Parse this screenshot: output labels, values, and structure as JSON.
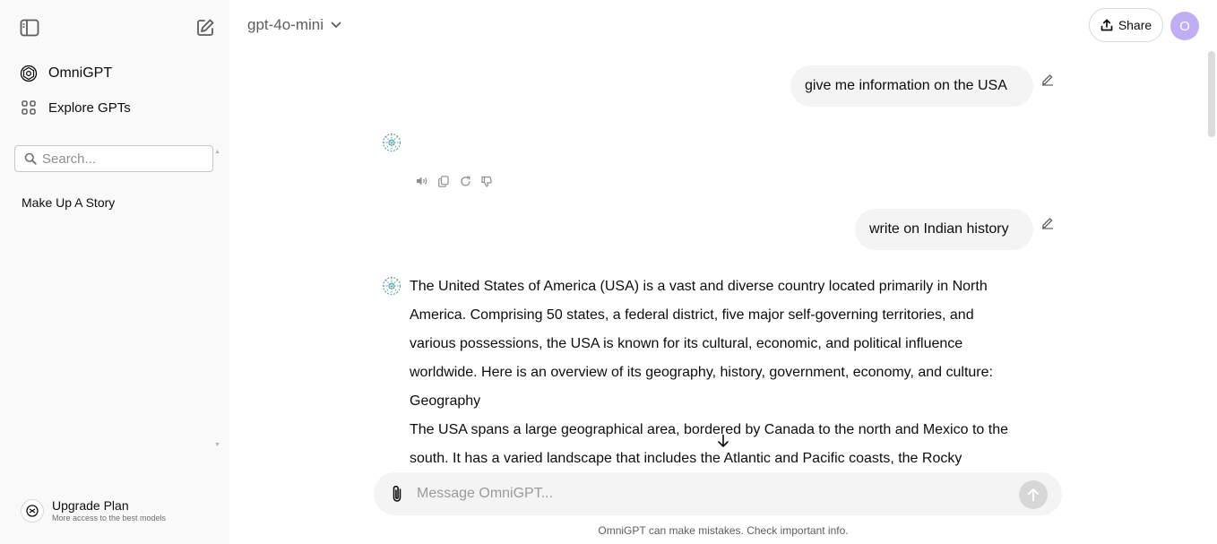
{
  "sidebar": {
    "brand_label": "OmniGPT",
    "explore_label": "Explore GPTs",
    "search_placeholder": "Search...",
    "history": [
      "Make Up A Story"
    ],
    "upgrade_title": "Upgrade Plan",
    "upgrade_subtitle": "More access to the best models"
  },
  "header": {
    "model": "gpt-4o-mini",
    "share_label": "Share",
    "avatar_initial": "O"
  },
  "chat": {
    "user_message_1": "give me information on the USA",
    "user_message_2": "write on Indian history",
    "response_lines": [
      "The United States of America (USA) is a vast and diverse country located primarily in North",
      "America. Comprising 50 states, a federal district, five major self-governing territories, and",
      "various possessions, the USA is known for its cultural, economic, and political influence",
      "worldwide. Here is an overview of its geography, history, government, economy, and culture:",
      "Geography",
      "The USA spans a large geographical area, bordered by Canada to the north and Mexico to the",
      "south. It has a varied landscape that includes the Atlantic and Pacific coasts, the Rocky"
    ]
  },
  "composer": {
    "placeholder": "Message OmniGPT..."
  },
  "footer": {
    "disclaimer": "OmniGPT can make mistakes. Check important info."
  },
  "colors": {
    "sidebar_bg": "#f9f9f9",
    "bubble_bg": "#f4f4f4",
    "avatar_bg": "#c0aef4",
    "logo_green": "#5cb88a",
    "logo_blue": "#4a8fd6"
  }
}
